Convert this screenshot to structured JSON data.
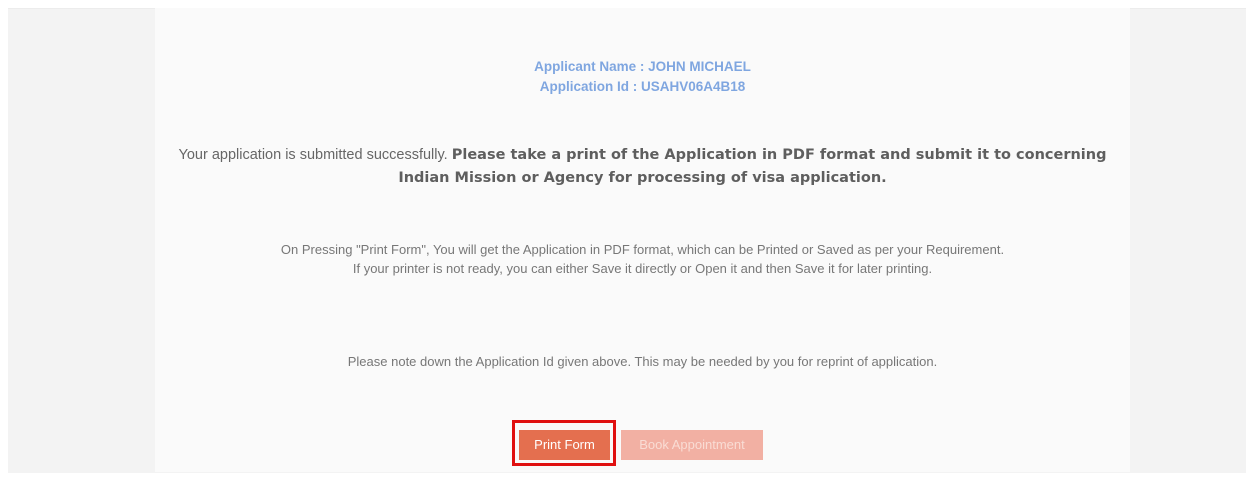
{
  "applicant": {
    "name_line": "Applicant Name : JOHN MICHAEL",
    "id_line": "Application Id : USAHV06A4B18"
  },
  "success": {
    "lead": "Your application is submitted successfully.",
    "emphasis": "Please take a print of the Application in PDF format and submit it to concerning Indian Mission or Agency for processing of visa application."
  },
  "instructions": {
    "line1": "On Pressing \"Print Form\", You will get the Application in PDF format, which can be Printed or Saved as per your Requirement.",
    "line2": "If your printer is not ready, you can either Save it directly or Open it and then Save it for later printing."
  },
  "note": "Please note down the Application Id given above. This may be needed by you for reprint of application.",
  "actions": {
    "print_label": "Print Form",
    "book_label": "Book Appointment"
  },
  "colors": {
    "applicant_text": "#7fa6e0",
    "primary_button": "#e46f4f",
    "disabled_button": "#f2b0a3",
    "highlight": "#e01010"
  }
}
